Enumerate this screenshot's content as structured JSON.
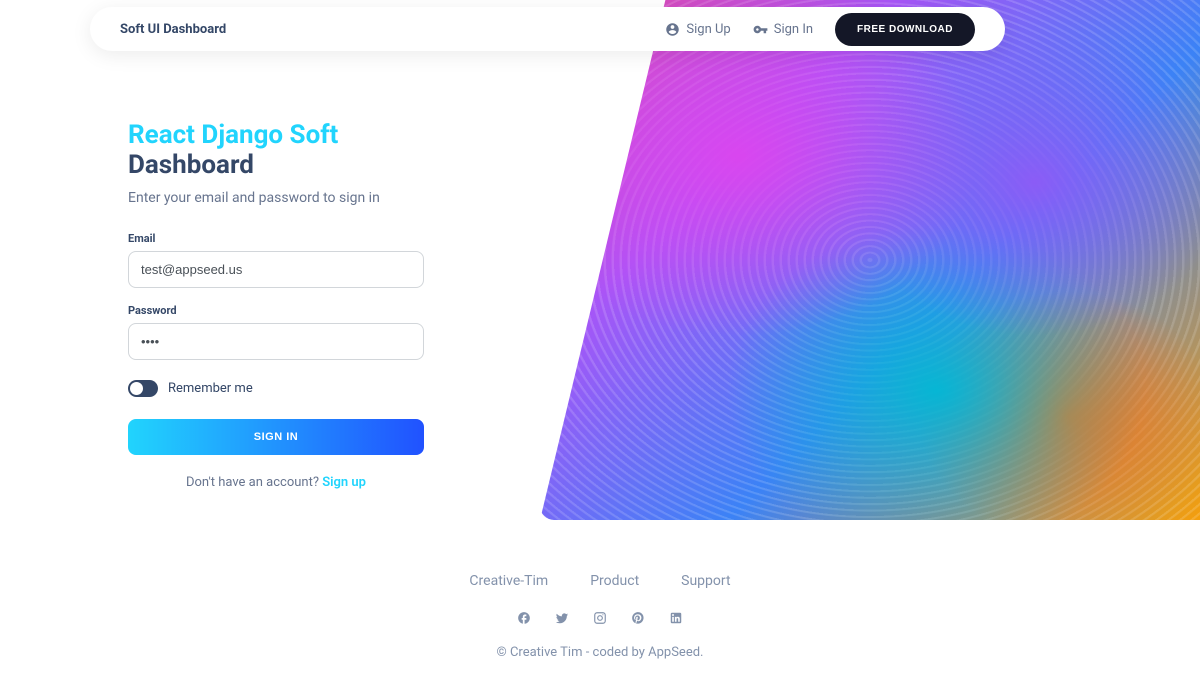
{
  "nav": {
    "brand": "Soft UI Dashboard",
    "signup": "Sign Up",
    "signin": "Sign In",
    "download": "FREE DOWNLOAD"
  },
  "signin": {
    "title_part1": "React Django Soft ",
    "title_part2": "Dashboard",
    "subtitle": "Enter your email and password to sign in",
    "email_label": "Email",
    "email_value": "test@appseed.us",
    "password_label": "Password",
    "password_value": "pass",
    "remember": "Remember me",
    "button": "SIGN IN",
    "prompt": "Don't have an account? ",
    "signup_link": "Sign up"
  },
  "footer": {
    "links": [
      "Creative-Tim",
      "Product",
      "Support"
    ],
    "copyright": "© Creative Tim - coded by AppSeed."
  }
}
